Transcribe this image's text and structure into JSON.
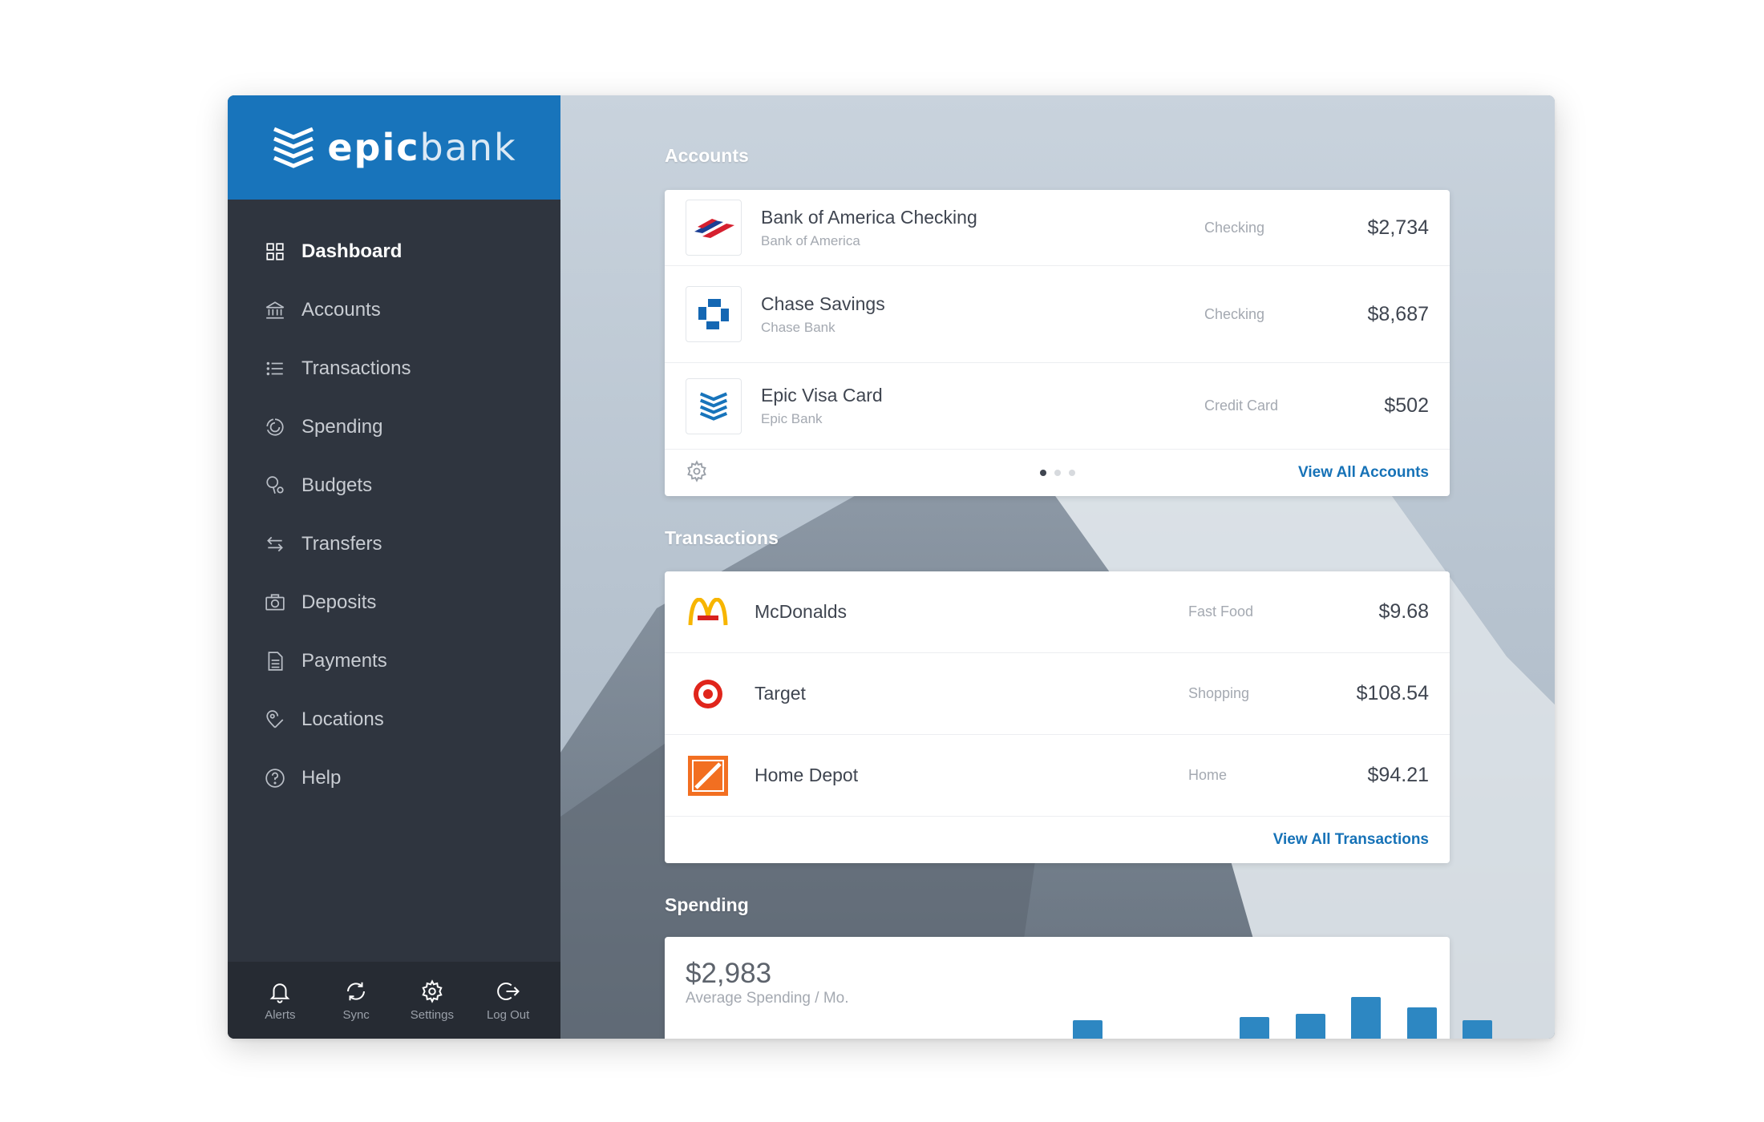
{
  "brand": {
    "name_bold": "epic",
    "name_light": "bank",
    "color": "#1874bb"
  },
  "nav": [
    {
      "label": "Dashboard",
      "icon": "dashboard-icon",
      "active": true
    },
    {
      "label": "Accounts",
      "icon": "bank-icon"
    },
    {
      "label": "Transactions",
      "icon": "list-icon"
    },
    {
      "label": "Spending",
      "icon": "pie-icon"
    },
    {
      "label": "Budgets",
      "icon": "budget-icon"
    },
    {
      "label": "Transfers",
      "icon": "transfer-icon"
    },
    {
      "label": "Deposits",
      "icon": "camera-icon"
    },
    {
      "label": "Payments",
      "icon": "document-icon"
    },
    {
      "label": "Locations",
      "icon": "location-icon"
    },
    {
      "label": "Help",
      "icon": "help-icon"
    }
  ],
  "footer": [
    {
      "label": "Alerts",
      "icon": "bell-icon"
    },
    {
      "label": "Sync",
      "icon": "sync-icon"
    },
    {
      "label": "Settings",
      "icon": "gear-icon"
    },
    {
      "label": "Log Out",
      "icon": "logout-icon"
    }
  ],
  "accounts": {
    "title": "Accounts",
    "items": [
      {
        "name": "Bank of America Checking",
        "institution": "Bank of America",
        "type": "Checking",
        "amount": "$2,734"
      },
      {
        "name": "Chase Savings",
        "institution": "Chase Bank",
        "type": "Checking",
        "amount": "$8,687"
      },
      {
        "name": "Epic Visa Card",
        "institution": "Epic Bank",
        "type": "Credit Card",
        "amount": "$502"
      }
    ],
    "view_all": "View All Accounts",
    "page_dots": 3,
    "active_dot": 0
  },
  "transactions": {
    "title": "Transactions",
    "items": [
      {
        "merchant": "McDonalds",
        "category": "Fast Food",
        "amount": "$9.68"
      },
      {
        "merchant": "Target",
        "category": "Shopping",
        "amount": "$108.54"
      },
      {
        "merchant": "Home Depot",
        "category": "Home",
        "amount": "$94.21"
      }
    ],
    "view_all": "View All Transactions"
  },
  "spending": {
    "title": "Spending",
    "amount": "$2,983",
    "subtitle": "Average Spending / Mo."
  },
  "chart_data": {
    "type": "bar",
    "values": [
      0,
      0,
      0,
      3,
      0,
      0,
      4,
      5,
      10,
      7,
      3
    ],
    "ylim": [
      0,
      10
    ]
  },
  "colors": {
    "accent": "#1874bb",
    "link": "#1672b7",
    "bar": "#2d87c2",
    "sidebar": "#2f353f"
  }
}
